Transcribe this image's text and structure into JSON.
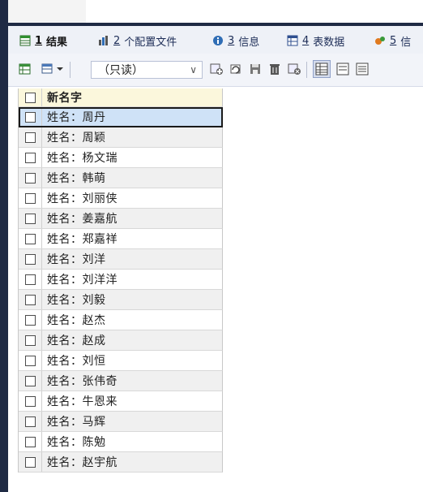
{
  "tabs": [
    {
      "num": "1",
      "label": "结果",
      "icon": "result-grid-icon",
      "active": true
    },
    {
      "num": "2",
      "label": "个配置文件",
      "icon": "profile-icon",
      "active": false
    },
    {
      "num": "3",
      "label": "信息",
      "icon": "info-icon",
      "active": false
    },
    {
      "num": "4",
      "label": "表数据",
      "icon": "table-data-icon",
      "active": false
    },
    {
      "num": "5",
      "label": "信",
      "icon": "status-icon",
      "active": false
    }
  ],
  "toolbar": {
    "mode_select": "（只读）",
    "icons": [
      "export-grid-icon",
      "filter-menu-icon",
      "add-row-icon",
      "refresh-icon",
      "save-icon",
      "delete-icon",
      "clear-icon",
      "grid-view-icon",
      "form-view-icon",
      "text-view-icon"
    ]
  },
  "grid": {
    "header": "新名字",
    "rows": [
      "姓名：周丹",
      "姓名：周颖",
      "姓名：杨文瑞",
      "姓名：韩萌",
      "姓名：刘丽侠",
      "姓名：姜嘉航",
      "姓名：郑嘉祥",
      "姓名：刘洋",
      "姓名：刘洋洋",
      "姓名：刘毅",
      "姓名：赵杰",
      "姓名：赵成",
      "姓名：刘恒",
      "姓名：张伟奇",
      "姓名：牛恩来",
      "姓名：马辉",
      "姓名：陈勉",
      "姓名：赵宇航"
    ],
    "selected_index": 0
  },
  "colors": {
    "frame": "#1f2a44",
    "header_bg": "#fbf7dc",
    "selected_bg": "#cfe2f7"
  }
}
